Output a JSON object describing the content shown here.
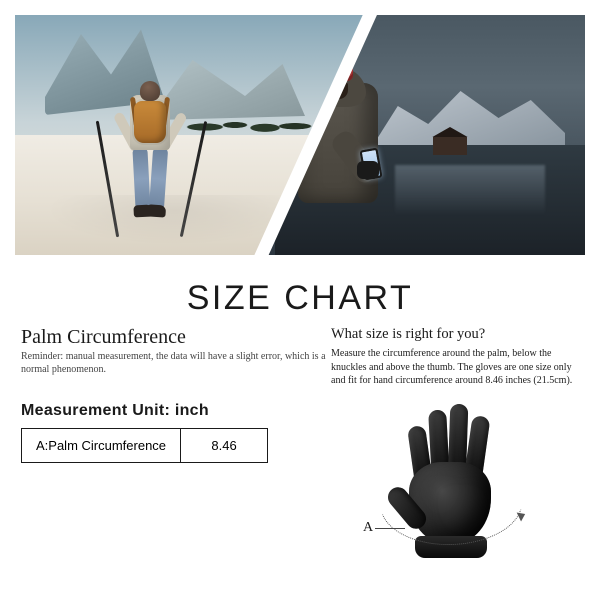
{
  "title": "SIZE CHART",
  "left": {
    "heading": "Palm Circumference",
    "reminder": "Reminder: manual measurement, the data will have a slight error, which is a normal phenomenon.",
    "unit_label": "Measurement Unit: inch",
    "table": {
      "row_label": "A:Palm Circumference",
      "value": "8.46"
    }
  },
  "right": {
    "question": "What size is right for you?",
    "description": "Measure the circumference around the palm, below the knuckles and above the thumb. The gloves are one size only and fit for hand circumference around 8.46 inches (21.5cm).",
    "marker": "A"
  },
  "hero": {
    "left_scene": "hiker with backpack and trekking poles in snowy mountains",
    "right_scene": "man in hooded jacket and red beanie looking at phone by a mountain lake"
  }
}
